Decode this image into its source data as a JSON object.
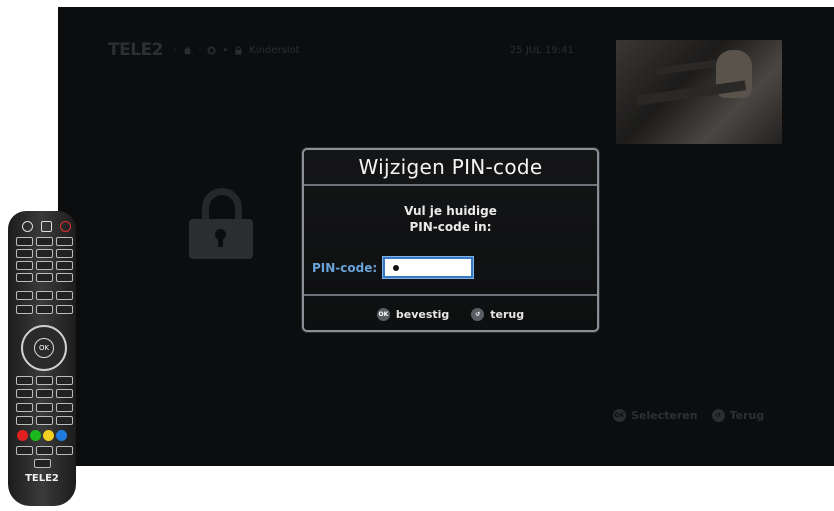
{
  "header": {
    "logo": "TELE2",
    "breadcrumb_item": "Kinderslot",
    "datetime": "25 JUL 19:41"
  },
  "dialog": {
    "title": "Wijzigen PIN-code",
    "message_line1": "Vul je huidige",
    "message_line2": "PIN-code in:",
    "pin_label": "PIN-code:",
    "pin_value": "•",
    "confirm_label": "bevestig",
    "back_label": "terug",
    "ok_key": "OK"
  },
  "hints": {
    "select_label": "Selecteren",
    "back_label": "Terug"
  },
  "remote": {
    "logo": "TELE2",
    "ok_key": "OK",
    "colors": [
      "#e02020",
      "#1db81d",
      "#f0d020",
      "#1e7be0"
    ]
  },
  "colors": {
    "accent": "#3a78c4",
    "label_blue": "#6aa3d8",
    "screen_bg": "#0c0d0e"
  }
}
